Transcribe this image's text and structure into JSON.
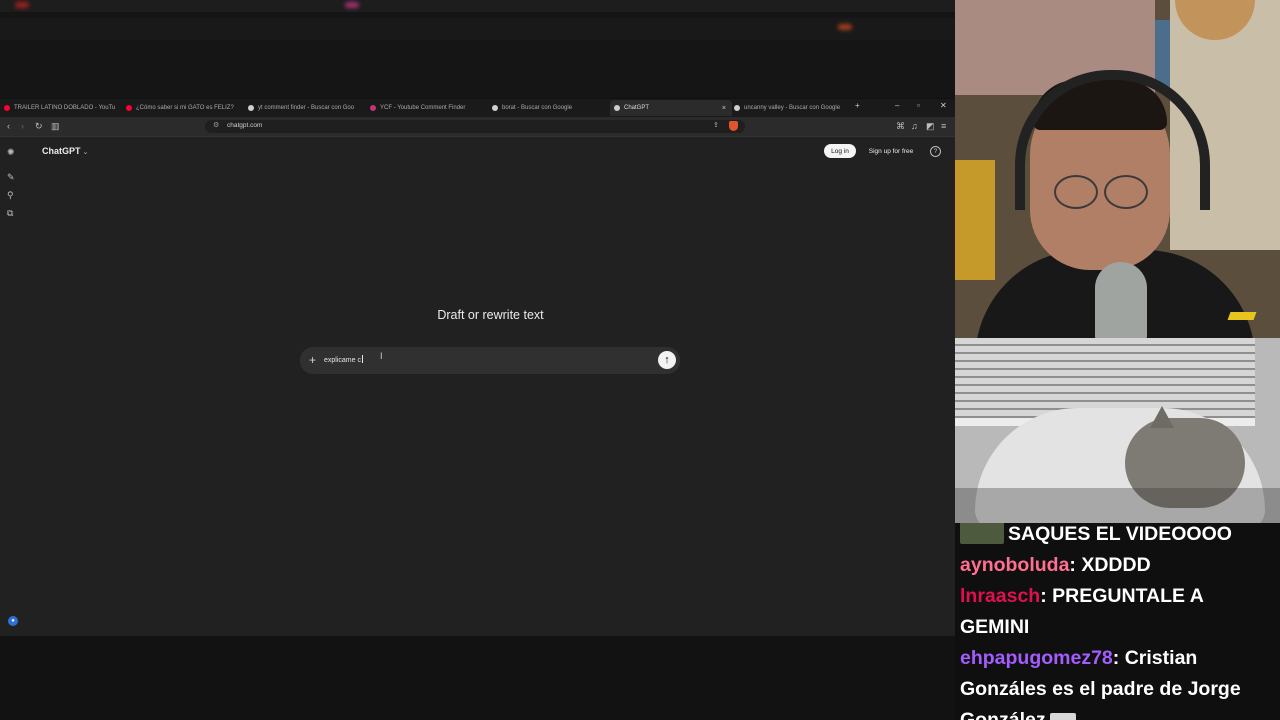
{
  "browser": {
    "tabs": [
      {
        "label": "TRAILER LATINO DOBLADO - YouTu",
        "color": "#ff0033"
      },
      {
        "label": "¿Cómo saber si mi GATO es FELIZ?",
        "color": "#ff0033"
      },
      {
        "label": "yt comment finder - Buscar con Goo",
        "color": "#cfcfcf"
      },
      {
        "label": "YCF - Youtube Comment Finder",
        "color": "#c2337a"
      },
      {
        "label": "borat - Buscar con Google",
        "color": "#cfcfcf"
      },
      {
        "label": "ChatGPT",
        "color": "#cfcfcf",
        "active": true
      },
      {
        "label": "uncanny valley - Buscar con Google",
        "color": "#cfcfcf"
      }
    ],
    "new_tab": "+",
    "close_tab": "×",
    "window_controls": {
      "minimize": "–",
      "restore": "▫",
      "close": "✕"
    },
    "toolbar": {
      "back": "‹",
      "forward": "›",
      "reload": "↻",
      "sidebar": "▥",
      "menu": "≡"
    },
    "url": "chatgpt.com"
  },
  "chatgpt": {
    "model": "ChatGPT",
    "login": "Log in",
    "signup": "Sign up for free",
    "help": "?",
    "headline": "Draft or rewrite text",
    "composer": {
      "plus": "+",
      "value": "explicame c",
      "send": "↑"
    }
  },
  "chat": [
    {
      "user": "",
      "user_color": "#ffffff",
      "message": "SAQUES EL VIDEOOOO",
      "avatar": true
    },
    {
      "user": "aynoboluda",
      "user_color": "#ff6f8f",
      "message": "XDDDD"
    },
    {
      "user": "lnraasch",
      "user_color": "#e0104f",
      "message": "PREGUNTALE A"
    },
    {
      "user": "",
      "user_color": "#ffffff",
      "message": "GEMINI"
    },
    {
      "user": "ehpapugomez78",
      "user_color": "#a35cff",
      "message": "Cristian"
    },
    {
      "user": "",
      "user_color": "#ffffff",
      "message": "Gonzáles es el padre de Jorge"
    },
    {
      "user": "",
      "user_color": "#ffffff",
      "message": "González",
      "emote": true
    }
  ]
}
